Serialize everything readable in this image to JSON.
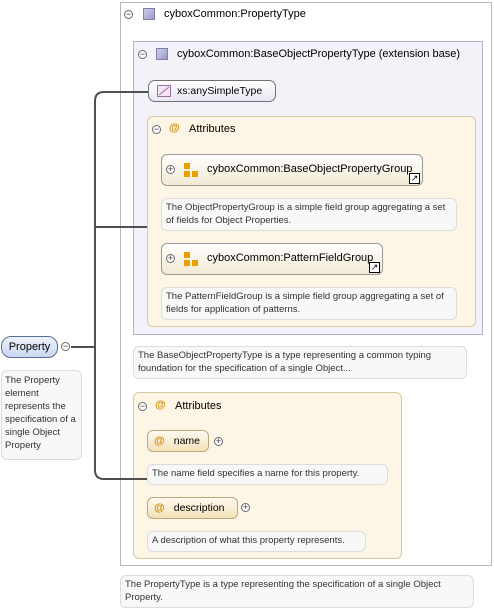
{
  "property_type": {
    "label": "cyboxCommon:PropertyType",
    "description": "The PropertyType is a type representing the specification of a single Object Property."
  },
  "base_type": {
    "label": "cyboxCommon:BaseObjectPropertyType (extension base)",
    "description": "The BaseObjectPropertyType is a type representing a common typing foundation for the specification of a single Object..."
  },
  "simple_type": {
    "label": "xs:anySimpleType"
  },
  "base_attributes": {
    "label": "Attributes",
    "groups": [
      {
        "label": "cyboxCommon:BaseObjectPropertyGroup",
        "description": "The ObjectPropertyGroup is a simple field group aggregating a set of fields for Object Properties."
      },
      {
        "label": "cyboxCommon:PatternFieldGroup",
        "description": "The PatternFieldGroup is a simple field group aggregating a set of fields for application of patterns."
      }
    ]
  },
  "attributes": {
    "label": "Attributes",
    "items": [
      {
        "name": "name",
        "description": "The name field specifies a name for this property."
      },
      {
        "name": "description",
        "description": "A description of what this property represents."
      }
    ]
  },
  "root": {
    "label": "Property",
    "description": "The Property element represents the specification of a single Object Property"
  },
  "glyphs": {
    "collapse": "−",
    "expand": "+",
    "at": "@",
    "link": "↗"
  },
  "colors": {
    "root_fill": "#dbe6f6",
    "attr_fill": "#fdf6e6",
    "accent": "#d28a00",
    "type_icon": "#a0a0d0"
  }
}
